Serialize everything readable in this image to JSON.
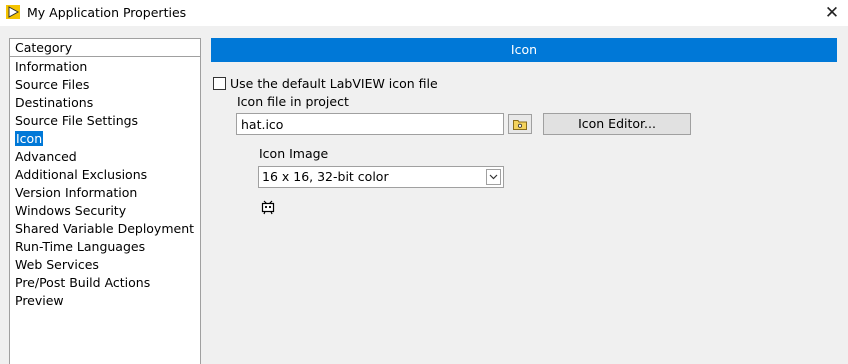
{
  "window": {
    "title": "My Application Properties",
    "app_icon": "labview-run-arrow-icon",
    "close_glyph": "✕"
  },
  "sidebar": {
    "header": "Category",
    "items": [
      {
        "label": "Information"
      },
      {
        "label": "Source Files"
      },
      {
        "label": "Destinations"
      },
      {
        "label": "Source File Settings"
      },
      {
        "label": "Icon",
        "selected": true
      },
      {
        "label": "Advanced"
      },
      {
        "label": "Additional Exclusions"
      },
      {
        "label": "Version Information"
      },
      {
        "label": "Windows Security"
      },
      {
        "label": "Shared Variable Deployment"
      },
      {
        "label": "Run-Time Languages"
      },
      {
        "label": "Web Services"
      },
      {
        "label": "Pre/Post Build Actions"
      },
      {
        "label": "Preview"
      }
    ]
  },
  "main": {
    "section_title": "Icon",
    "use_default_checkbox": {
      "label": "Use the default LabVIEW icon file",
      "checked": false
    },
    "icon_file": {
      "label": "Icon file in project",
      "value": "hat.ico",
      "browse_icon": "folder-icon"
    },
    "icon_editor_button": "Icon Editor...",
    "icon_image": {
      "label": "Icon Image",
      "selected": "16 x 16, 32-bit color",
      "preview_icon": "hat-preview-icon"
    }
  },
  "colors": {
    "accent": "#0078d7",
    "window_bg": "#f0f0f0",
    "border": "#a0a0a0"
  }
}
